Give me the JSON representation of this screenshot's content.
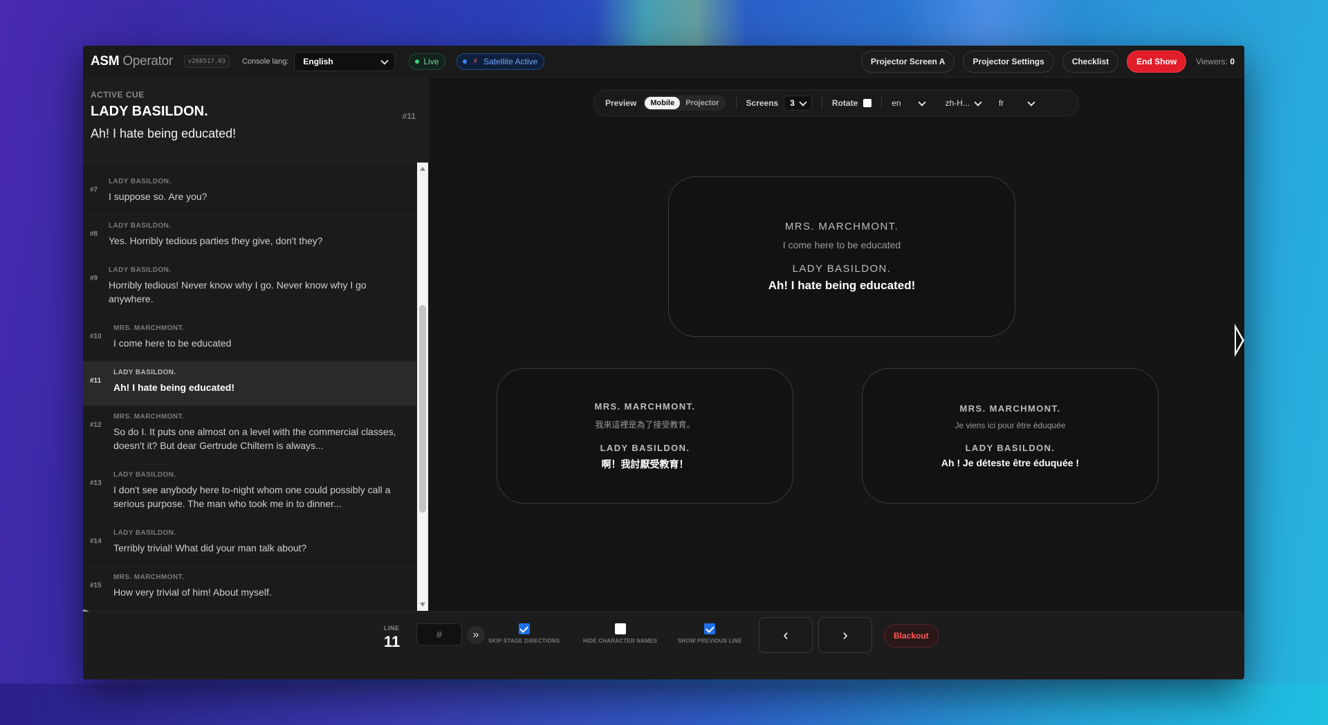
{
  "app": {
    "brand_strong": "ASM",
    "brand_light": "Operator",
    "version": "v260517.03",
    "console_lang_label": "Console lang:",
    "console_lang_value": "English",
    "live_label": "Live",
    "satellite_label": "Satellite Active",
    "buttons": {
      "projector_screen": "Projector Screen A",
      "projector_settings": "Projector Settings",
      "checklist": "Checklist",
      "end_show": "End Show"
    },
    "viewers_label": "Viewers:",
    "viewers_count": "0"
  },
  "active_cue": {
    "label": "ACTIVE CUE",
    "character": "LADY BASILDON.",
    "number": "#11",
    "line": "Ah! I hate being educated!"
  },
  "cues": [
    {
      "num": "#7",
      "char": "LADY BASILDON.",
      "text": "I suppose so. Are you?"
    },
    {
      "num": "#8",
      "char": "LADY BASILDON.",
      "text": "Yes. Horribly tedious parties they give, don't they?"
    },
    {
      "num": "#9",
      "char": "LADY BASILDON.",
      "text": "Horribly tedious! Never know why I go. Never know why I go anywhere."
    },
    {
      "num": "#10",
      "char": "MRS. MARCHMONT.",
      "text": "I come here to be educated"
    },
    {
      "num": "#11",
      "char": "LADY BASILDON.",
      "text": "Ah! I hate being educated!"
    },
    {
      "num": "#12",
      "char": "MRS. MARCHMONT.",
      "text": "So do I. It puts one almost on a level with the commercial classes, doesn't it? But dear Gertrude Chiltern is always..."
    },
    {
      "num": "#13",
      "char": "LADY BASILDON.",
      "text": "I don't see anybody here to-night whom one could possibly call a serious purpose. The man who took me in to dinner..."
    },
    {
      "num": "#14",
      "char": "LADY BASILDON.",
      "text": "Terribly trivial! What did your man talk about?"
    },
    {
      "num": "#15",
      "char": "MRS. MARCHMONT.",
      "text": "How very trivial of him! About myself."
    }
  ],
  "toolbar": {
    "preview_label": "Preview",
    "mode_mobile": "Mobile",
    "mode_projector": "Projector",
    "screens_label": "Screens",
    "screens_value": "3",
    "rotate_label": "Rotate",
    "langs": [
      "en",
      "zh-H...",
      "fr"
    ]
  },
  "screens": {
    "main": {
      "prev_char": "MRS. MARCHMONT.",
      "prev_line": "I come here to be educated",
      "cur_char": "LADY BASILDON.",
      "cur_line": "Ah! I hate being educated!"
    },
    "zh": {
      "prev_char": "MRS. MARCHMONT.",
      "prev_line": "我來這裡是為了接受教育。",
      "cur_char": "LADY BASILDON.",
      "cur_line": "啊！我討厭受教育！"
    },
    "fr": {
      "prev_char": "MRS. MARCHMONT.",
      "prev_line": "Je viens ici pour être éduquée",
      "cur_char": "LADY BASILDON.",
      "cur_line": "Ah ! Je déteste être éduquée !"
    }
  },
  "bottom": {
    "line_label": "LINE",
    "line_number": "11",
    "jump_placeholder": "#",
    "opt_skip": "SKIP STAGE DIRECTIONS",
    "opt_hide": "HIDE CHARACTER NAMES",
    "opt_show_prev": "SHOW PREVIOUS LINE",
    "blackout": "Blackout",
    "skip_checked": true,
    "hide_checked": false,
    "show_prev_checked": true
  },
  "icons": {
    "satellite": "bolt-icon",
    "jump": "double-chevron-right-icon",
    "prev": "chevron-left-icon",
    "next": "chevron-right-icon"
  },
  "colors": {
    "danger": "#e21d2a",
    "live": "#43d17a",
    "satellite": "#3a86ff",
    "check": "#1d6fe8"
  }
}
